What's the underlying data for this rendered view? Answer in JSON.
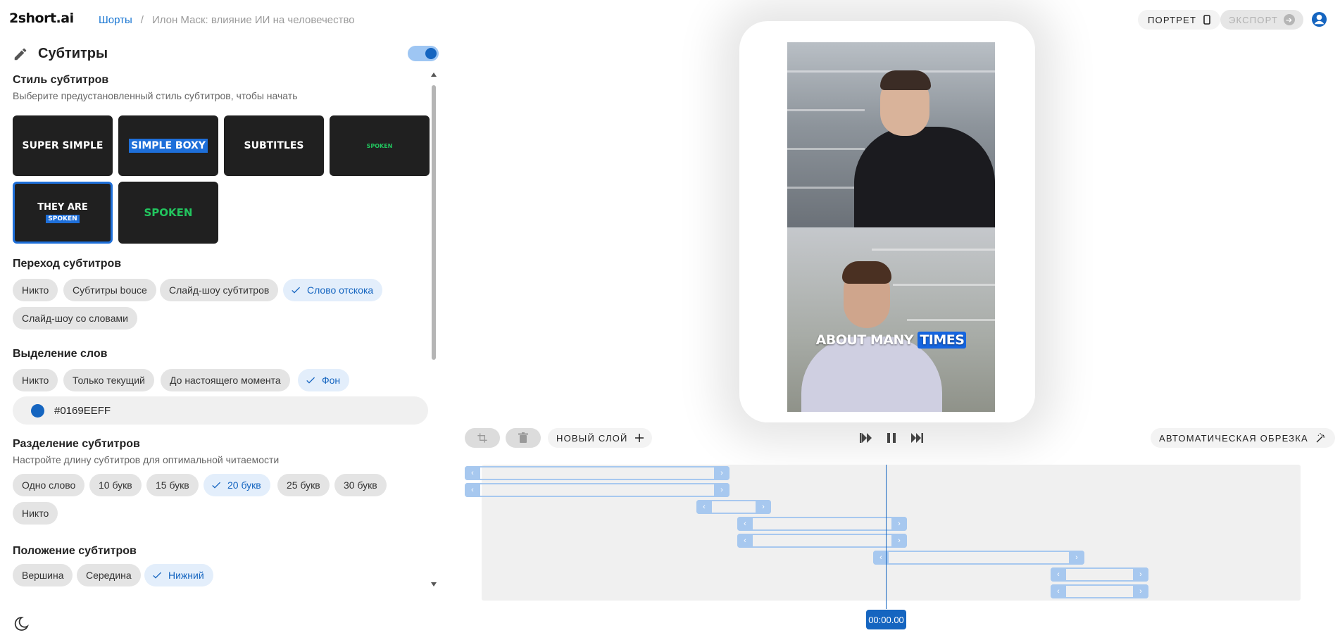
{
  "app": {
    "logo": "2short.ai",
    "breadcrumb": {
      "root": "Шорты",
      "separator": "/",
      "current": "Илон Маск: влияние ИИ на человечество"
    },
    "portrait_label": "ПОРТРЕТ",
    "export_label": "ЭКСПОРТ"
  },
  "panel": {
    "title": "Субтитры",
    "toggle_on": true,
    "style": {
      "title": "Стиль субтитров",
      "subtitle": "Выберите предустановленный стиль субтитров, чтобы начать",
      "cards": [
        {
          "label": "SUPER SIMPLE"
        },
        {
          "label": "SIMPLE BOXY"
        },
        {
          "label": "SUBTITLES"
        },
        {
          "label": "SPOKEN"
        },
        {
          "line1": "THEY ARE",
          "line2": "SPOKEN"
        },
        {
          "label": "SPOKEN"
        }
      ],
      "accent_color": "#1e6fd9",
      "green_color": "#22c55e"
    },
    "transition": {
      "title": "Переход субтитров",
      "options": [
        "Никто",
        "Субтитры bouce",
        "Слайд-шоу субтитров",
        "Слово отскока",
        "Слайд-шоу со словами"
      ],
      "selected": "Слово отскока"
    },
    "highlight": {
      "title": "Выделение слов",
      "options": [
        "Никто",
        "Только текущий",
        "До настоящего момента",
        "Фон"
      ],
      "selected": "Фон",
      "color_value": "#0169EEFF"
    },
    "split": {
      "title": "Разделение субтитров",
      "subtitle": "Настройте длину субтитров для оптимальной читаемости",
      "options": [
        "Одно слово",
        "10 букв",
        "15 букв",
        "20 букв",
        "25 букв",
        "30 букв",
        "Никто"
      ],
      "selected": "20 букв"
    },
    "position": {
      "title": "Положение субтитров",
      "options": [
        "Вершина",
        "Середина",
        "Нижний"
      ],
      "selected": "Нижний"
    }
  },
  "preview": {
    "caption_plain": "ABOUT MANY",
    "caption_highlight": "TIMES"
  },
  "toolbar": {
    "new_layer_label": "НОВЫЙ СЛОЙ",
    "auto_crop_label": "АВТОМАТИЧЕСКАЯ ОБРЕЗКА"
  },
  "timeline": {
    "current_time": "00:00.00"
  },
  "icons": [
    "pencil-icon",
    "crop-icon",
    "trash-icon",
    "plus-icon",
    "skip-back-icon",
    "pause-icon",
    "skip-forward-icon",
    "magic-wand-icon",
    "phone-icon",
    "arrow-right-icon",
    "user-icon",
    "moon-icon",
    "check-icon"
  ]
}
